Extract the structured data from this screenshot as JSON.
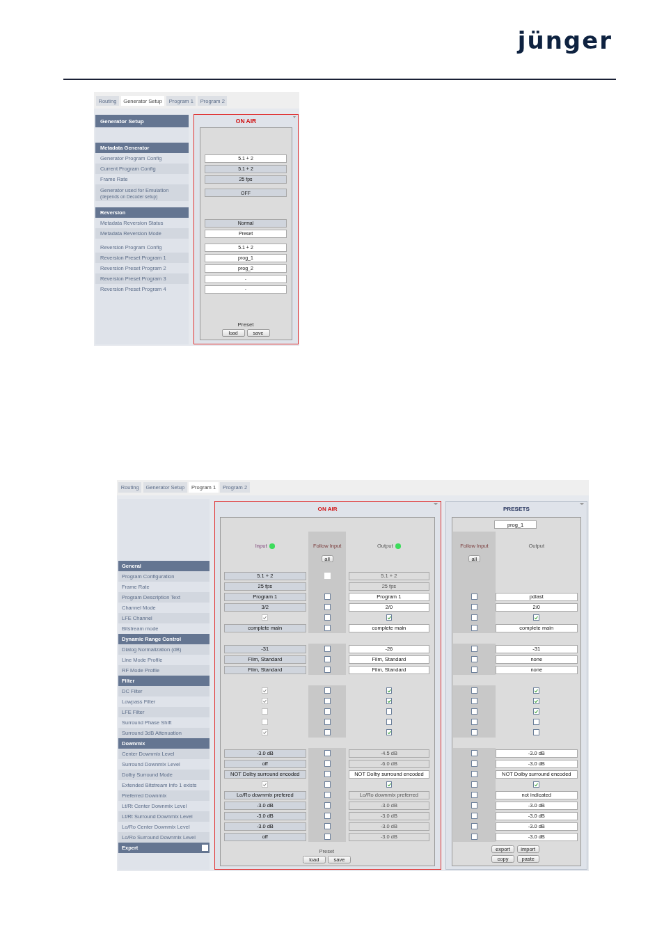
{
  "logo": {
    "text": "jünger"
  },
  "generator_view": {
    "tabs": [
      {
        "label": "Routing",
        "selected": false
      },
      {
        "label": "Generator Setup",
        "selected": true
      },
      {
        "label": "Program 1",
        "selected": false
      },
      {
        "label": "Program 2",
        "selected": false
      }
    ],
    "sidebar_title": "Generator Setup",
    "sections": [
      {
        "title": "Metadata Generator",
        "groups": [
          [
            {
              "label": "Generator Program Config",
              "value": "5.1 + 2",
              "editable": true
            },
            {
              "label": "Current Program Config",
              "value": "5.1 + 2",
              "editable": false
            },
            {
              "label": "Frame Rate",
              "value": "25 fps",
              "editable": false
            },
            {
              "label": "Generator used for Emulation",
              "note": "(depends on Decoder setup)",
              "value": "OFF",
              "editable": false
            }
          ]
        ]
      },
      {
        "title": "Reversion",
        "groups": [
          [
            {
              "label": "Metadata Reversion Status",
              "value": "Normal",
              "editable": false
            },
            {
              "label": "Metadata Reversion Mode",
              "value": "Preset",
              "editable": true
            }
          ],
          [
            {
              "label": "Reversion Program Config",
              "value": "5.1 + 2",
              "editable": true
            },
            {
              "label": "Reversion Preset Program 1",
              "value": "prog_1",
              "editable": true
            },
            {
              "label": "Reversion Preset Program 2",
              "value": "prog_2",
              "editable": true
            },
            {
              "label": "Reversion Preset Program 3",
              "value": "-",
              "editable": true
            },
            {
              "label": "Reversion Preset Program 4",
              "value": "-",
              "editable": true
            }
          ]
        ]
      }
    ],
    "panel": {
      "title": "ON AIR",
      "footer_label": "Preset",
      "buttons": [
        "load",
        "save"
      ]
    }
  },
  "program_view": {
    "tabs": [
      {
        "label": "Routing",
        "selected": false
      },
      {
        "label": "Generator Setup",
        "selected": false
      },
      {
        "label": "Program 1",
        "selected": true
      },
      {
        "label": "Program 2",
        "selected": false
      }
    ],
    "sections": [
      {
        "title": "General",
        "rows": [
          {
            "label": "Program Configuration",
            "input": {
              "kind": "field",
              "value": "5.1 + 2",
              "editable": false
            },
            "follow": {
              "checked": false,
              "disabled": true
            },
            "output": {
              "kind": "field",
              "value": "5.1 + 2",
              "editable": false
            }
          },
          {
            "label": "Frame Rate",
            "input": {
              "kind": "field",
              "value": "25 fps",
              "editable": false
            },
            "output": {
              "kind": "field",
              "value": "25 fps",
              "editable": false
            }
          },
          {
            "label": "Program Description Text",
            "input": {
              "kind": "field",
              "value": "Program 1",
              "editable": false
            },
            "follow": {
              "checked": false,
              "disabled": false
            },
            "output": {
              "kind": "field",
              "value": "Program 1",
              "editable": true
            },
            "preset_follow": {
              "checked": false,
              "disabled": false
            },
            "preset_output": {
              "kind": "field",
              "value": "pdlast",
              "editable": true
            }
          },
          {
            "label": "Channel Mode",
            "input": {
              "kind": "field",
              "value": "3/2",
              "editable": false
            },
            "follow": {
              "checked": false,
              "disabled": false
            },
            "output": {
              "kind": "field",
              "value": "2/0",
              "editable": true
            },
            "preset_follow": {
              "checked": false,
              "disabled": false
            },
            "preset_output": {
              "kind": "field",
              "value": "2/0",
              "editable": true
            }
          },
          {
            "label": "LFE Channel",
            "input": {
              "kind": "check",
              "checked": true,
              "disabled": true
            },
            "follow": {
              "checked": false,
              "disabled": false
            },
            "output": {
              "kind": "check",
              "checked": true,
              "disabled": false
            },
            "preset_follow": {
              "checked": false,
              "disabled": false
            },
            "preset_output": {
              "kind": "check",
              "checked": true,
              "disabled": false
            }
          },
          {
            "label": "Bitstream mode",
            "input": {
              "kind": "field",
              "value": "complete main",
              "editable": false
            },
            "follow": {
              "checked": false,
              "disabled": false
            },
            "output": {
              "kind": "field",
              "value": "complete main",
              "editable": true
            },
            "preset_follow": {
              "checked": false,
              "disabled": false
            },
            "preset_output": {
              "kind": "field",
              "value": "complete main",
              "editable": true
            }
          }
        ]
      },
      {
        "title": "Dynamic Range Control",
        "rows": [
          {
            "label": "Dialog Normalization (dB)",
            "input": {
              "kind": "field",
              "value": "-31",
              "editable": false
            },
            "follow": {
              "checked": false,
              "disabled": false
            },
            "output": {
              "kind": "field",
              "value": "-26",
              "editable": true
            },
            "preset_follow": {
              "checked": false,
              "disabled": false
            },
            "preset_output": {
              "kind": "field",
              "value": "-31",
              "editable": true
            }
          },
          {
            "label": "Line Mode Profile",
            "input": {
              "kind": "field",
              "value": "Film, Standard",
              "editable": false
            },
            "follow": {
              "checked": false,
              "disabled": false
            },
            "output": {
              "kind": "field",
              "value": "Film, Standard",
              "editable": true
            },
            "preset_follow": {
              "checked": false,
              "disabled": false
            },
            "preset_output": {
              "kind": "field",
              "value": "none",
              "editable": true
            }
          },
          {
            "label": "RF Mode Profile",
            "input": {
              "kind": "field",
              "value": "Film, Standard",
              "editable": false
            },
            "follow": {
              "checked": false,
              "disabled": false
            },
            "output": {
              "kind": "field",
              "value": "Film, Standard",
              "editable": true
            },
            "preset_follow": {
              "checked": false,
              "disabled": false
            },
            "preset_output": {
              "kind": "field",
              "value": "none",
              "editable": true
            }
          }
        ]
      },
      {
        "title": "Filter",
        "rows": [
          {
            "label": "DC Filter",
            "input": {
              "kind": "check",
              "checked": true,
              "disabled": true
            },
            "follow": {
              "checked": false,
              "disabled": false
            },
            "output": {
              "kind": "check",
              "checked": true,
              "disabled": false
            },
            "preset_follow": {
              "checked": false,
              "disabled": false
            },
            "preset_output": {
              "kind": "check",
              "checked": true,
              "disabled": false
            }
          },
          {
            "label": "Lowpass Filter",
            "input": {
              "kind": "check",
              "checked": true,
              "disabled": true
            },
            "follow": {
              "checked": false,
              "disabled": false
            },
            "output": {
              "kind": "check",
              "checked": true,
              "disabled": false
            },
            "preset_follow": {
              "checked": false,
              "disabled": false
            },
            "preset_output": {
              "kind": "check",
              "checked": true,
              "disabled": false
            }
          },
          {
            "label": "LFE Filter",
            "input": {
              "kind": "check",
              "checked": false,
              "disabled": true
            },
            "follow": {
              "checked": false,
              "disabled": false
            },
            "output": {
              "kind": "check",
              "checked": false,
              "disabled": false
            },
            "preset_follow": {
              "checked": false,
              "disabled": false
            },
            "preset_output": {
              "kind": "check",
              "checked": true,
              "disabled": false
            }
          },
          {
            "label": "Surround Phase Shift",
            "input": {
              "kind": "check",
              "checked": false,
              "disabled": true
            },
            "follow": {
              "checked": false,
              "disabled": false
            },
            "output": {
              "kind": "check",
              "checked": false,
              "disabled": false
            },
            "preset_follow": {
              "checked": false,
              "disabled": false
            },
            "preset_output": {
              "kind": "check",
              "checked": false,
              "disabled": false
            }
          },
          {
            "label": "Surround 3dB Attenuation",
            "input": {
              "kind": "check",
              "checked": true,
              "disabled": true
            },
            "follow": {
              "checked": false,
              "disabled": false
            },
            "output": {
              "kind": "check",
              "checked": true,
              "disabled": false
            },
            "preset_follow": {
              "checked": false,
              "disabled": false
            },
            "preset_output": {
              "kind": "check",
              "checked": false,
              "disabled": false
            }
          }
        ]
      },
      {
        "title": "Downmix",
        "rows": [
          {
            "label": "Center Downmix Level",
            "input": {
              "kind": "field",
              "value": "-3.0 dB",
              "editable": false
            },
            "follow": {
              "checked": false,
              "disabled": false
            },
            "output": {
              "kind": "field",
              "value": "-4.5 dB",
              "editable": false
            },
            "preset_follow": {
              "checked": false,
              "disabled": false
            },
            "preset_output": {
              "kind": "field",
              "value": "-3.0 dB",
              "editable": true
            }
          },
          {
            "label": "Surround Downmix Level",
            "input": {
              "kind": "field",
              "value": "off",
              "editable": false
            },
            "follow": {
              "checked": false,
              "disabled": false
            },
            "output": {
              "kind": "field",
              "value": "-6.0 dB",
              "editable": false
            },
            "preset_follow": {
              "checked": false,
              "disabled": false
            },
            "preset_output": {
              "kind": "field",
              "value": "-3.0 dB",
              "editable": true
            }
          },
          {
            "label": "Dolby Surround Mode",
            "input": {
              "kind": "field",
              "value": "NOT Dolby surround encoded",
              "editable": false
            },
            "follow": {
              "checked": false,
              "disabled": false
            },
            "output": {
              "kind": "field",
              "value": "NOT Dolby surround encoded",
              "editable": true
            },
            "preset_follow": {
              "checked": false,
              "disabled": false
            },
            "preset_output": {
              "kind": "field",
              "value": "NOT Dolby surround encoded",
              "editable": true
            }
          },
          {
            "label": "Extended Bitstream Info 1 exists",
            "input": {
              "kind": "check",
              "checked": true,
              "disabled": true
            },
            "follow": {
              "checked": false,
              "disabled": false
            },
            "output": {
              "kind": "check",
              "checked": true,
              "disabled": false
            },
            "preset_follow": {
              "checked": false,
              "disabled": false
            },
            "preset_output": {
              "kind": "check",
              "checked": true,
              "disabled": false
            }
          },
          {
            "label": "Preferred Downmix",
            "input": {
              "kind": "field",
              "value": "Lo/Ro downmix prefered",
              "editable": false
            },
            "follow": {
              "checked": false,
              "disabled": false
            },
            "output": {
              "kind": "field",
              "value": "Lo/Ro downmix preferred",
              "editable": false
            },
            "preset_follow": {
              "checked": false,
              "disabled": false
            },
            "preset_output": {
              "kind": "field",
              "value": "not indicated",
              "editable": true
            }
          },
          {
            "label": "Lt/Rt Center Downmix Level",
            "input": {
              "kind": "field",
              "value": "-3.0 dB",
              "editable": false
            },
            "follow": {
              "checked": false,
              "disabled": false
            },
            "output": {
              "kind": "field",
              "value": "-3.0 dB",
              "editable": false
            },
            "preset_follow": {
              "checked": false,
              "disabled": false
            },
            "preset_output": {
              "kind": "field",
              "value": "-3.0 dB",
              "editable": true
            }
          },
          {
            "label": "Lt/Rt Surround Downmix Level",
            "input": {
              "kind": "field",
              "value": "-3.0 dB",
              "editable": false
            },
            "follow": {
              "checked": false,
              "disabled": false
            },
            "output": {
              "kind": "field",
              "value": "-3.0 dB",
              "editable": false
            },
            "preset_follow": {
              "checked": false,
              "disabled": false
            },
            "preset_output": {
              "kind": "field",
              "value": "-3.0 dB",
              "editable": true
            }
          },
          {
            "label": "Lo/Ro Center Downmix Level",
            "input": {
              "kind": "field",
              "value": "-3.0 dB",
              "editable": false
            },
            "follow": {
              "checked": false,
              "disabled": false
            },
            "output": {
              "kind": "field",
              "value": "-3.0 dB",
              "editable": false
            },
            "preset_follow": {
              "checked": false,
              "disabled": false
            },
            "preset_output": {
              "kind": "field",
              "value": "-3.0 dB",
              "editable": true
            }
          },
          {
            "label": "Lo/Ro Surround Downmix Level",
            "input": {
              "kind": "field",
              "value": "off",
              "editable": false
            },
            "follow": {
              "checked": false,
              "disabled": false
            },
            "output": {
              "kind": "field",
              "value": "-3.0 dB",
              "editable": false
            },
            "preset_follow": {
              "checked": false,
              "disabled": false
            },
            "preset_output": {
              "kind": "field",
              "value": "-3.0 dB",
              "editable": true
            }
          }
        ]
      }
    ],
    "expert": {
      "label": "Expert",
      "checked": false
    },
    "on_air": {
      "title": "ON AIR",
      "columns": [
        {
          "label": "Input",
          "color": "#3ddc5c"
        },
        {
          "label": "Follow Input",
          "button": "all"
        },
        {
          "label": "Output",
          "color": "#3ddc5c"
        }
      ],
      "footer_label": "Preset",
      "buttons": [
        "load",
        "save"
      ]
    },
    "presets": {
      "title": "PRESETS",
      "name": "prog_1",
      "columns": [
        {
          "label": "Follow Input",
          "button": "all"
        },
        {
          "label": "Output"
        }
      ],
      "buttons": [
        "export",
        "import",
        "copy",
        "paste"
      ]
    }
  }
}
